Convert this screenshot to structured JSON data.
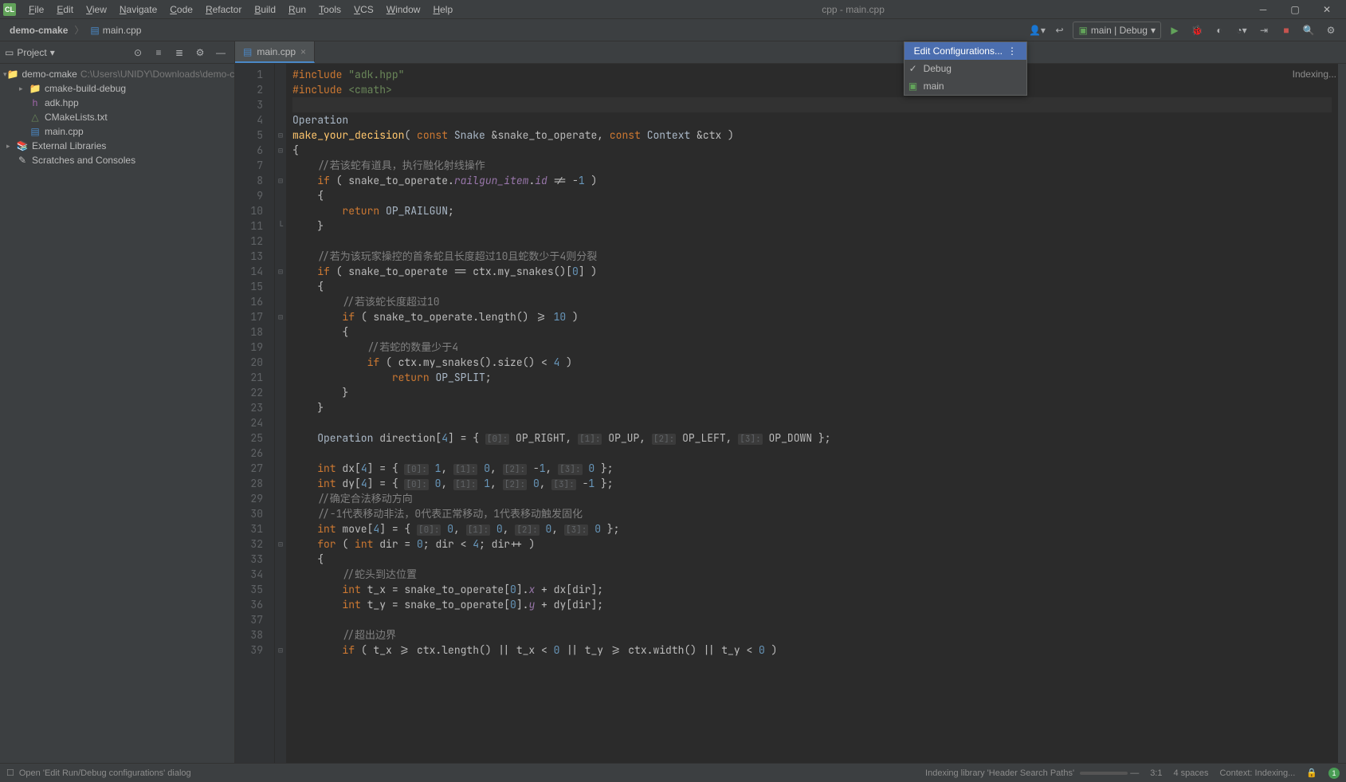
{
  "window_title": "cpp - main.cpp",
  "menu": [
    "File",
    "Edit",
    "View",
    "Navigate",
    "Code",
    "Refactor",
    "Build",
    "Run",
    "Tools",
    "VCS",
    "Window",
    "Help"
  ],
  "breadcrumb": {
    "project": "demo-cmake",
    "file_icon": "cpp",
    "file": "main.cpp"
  },
  "run_config_label": "main | Debug",
  "dropdown": {
    "edit": "Edit Configurations...",
    "items": [
      {
        "label": "Debug",
        "checked": true
      },
      {
        "label": "main",
        "checked": false,
        "icon": "app"
      }
    ]
  },
  "project_panel": {
    "title": "Project",
    "tree": [
      {
        "level": 0,
        "arrow": "▾",
        "icon": "folder",
        "label": "demo-cmake",
        "path": "C:\\Users\\UNIDY\\Downloads\\demo-cmake"
      },
      {
        "level": 1,
        "arrow": "▸",
        "icon": "folder",
        "label": "cmake-build-debug"
      },
      {
        "level": 1,
        "arrow": "",
        "icon": "hpp",
        "label": "adk.hpp"
      },
      {
        "level": 1,
        "arrow": "",
        "icon": "cmake",
        "label": "CMakeLists.txt"
      },
      {
        "level": 1,
        "arrow": "",
        "icon": "cpp",
        "label": "main.cpp"
      },
      {
        "level": 0,
        "arrow": "▸",
        "icon": "lib",
        "label": "External Libraries"
      },
      {
        "level": 0,
        "arrow": "",
        "icon": "scratch",
        "label": "Scratches and Consoles"
      }
    ]
  },
  "editor_tab": "main.cpp",
  "indexing_note": "Indexing...",
  "code_lines": [
    {
      "n": 1,
      "html": "<span class='kw'>#include</span> <span class='str'>\"adk.hpp\"</span>"
    },
    {
      "n": 2,
      "html": "<span class='kw'>#include</span> <span class='str'>&lt;cmath&gt;</span>"
    },
    {
      "n": 3,
      "html": ""
    },
    {
      "n": 4,
      "html": "<span class='type'>Operation</span>"
    },
    {
      "n": 5,
      "html": "<span class='fn'>make_your_decision</span>( <span class='kw'>const</span> <span class='type'>Snake</span> &amp;snake_to_operate, <span class='kw'>const</span> <span class='type'>Context</span> &amp;ctx )"
    },
    {
      "n": 6,
      "html": "{"
    },
    {
      "n": 7,
      "html": "    <span class='comment'>//若该蛇有道具，执行融化射线操作</span>"
    },
    {
      "n": 8,
      "html": "    <span class='kw'>if</span> ( snake_to_operate.<span class='purple'>railgun_item</span>.<span class='purple'>id</span> != -<span class='num'>1</span> )"
    },
    {
      "n": 9,
      "html": "    {"
    },
    {
      "n": 10,
      "html": "        <span class='kw'>return</span> <span class='ident'>OP_RAILGUN</span>;"
    },
    {
      "n": 11,
      "html": "    }"
    },
    {
      "n": 12,
      "html": ""
    },
    {
      "n": 13,
      "html": "    <span class='comment'>//若为该玩家操控的首条蛇且长度超过10且蛇数少于4则分裂</span>"
    },
    {
      "n": 14,
      "html": "    <span class='kw'>if</span> ( snake_to_operate == ctx.my_snakes()[<span class='num'>0</span>] )"
    },
    {
      "n": 15,
      "html": "    {"
    },
    {
      "n": 16,
      "html": "        <span class='comment'>//若该蛇长度超过10</span>"
    },
    {
      "n": 17,
      "html": "        <span class='kw'>if</span> ( snake_to_operate.length() &gt;= <span class='num'>10</span> )"
    },
    {
      "n": 18,
      "html": "        {"
    },
    {
      "n": 19,
      "html": "            <span class='comment'>//若蛇的数量少于4</span>"
    },
    {
      "n": 20,
      "html": "            <span class='kw'>if</span> ( ctx.my_snakes().size() &lt; <span class='num'>4</span> )"
    },
    {
      "n": 21,
      "html": "                <span class='kw'>return</span> <span class='ident'>OP_SPLIT</span>;"
    },
    {
      "n": 22,
      "html": "        }"
    },
    {
      "n": 23,
      "html": "    }"
    },
    {
      "n": 24,
      "html": ""
    },
    {
      "n": 25,
      "html": "    <span class='type'>Operation</span> direction[<span class='num'>4</span>] = { <span class='hint'>[0]:</span> OP_RIGHT, <span class='hint'>[1]:</span> OP_UP, <span class='hint'>[2]:</span> OP_LEFT, <span class='hint'>[3]:</span> OP_DOWN };"
    },
    {
      "n": 26,
      "html": ""
    },
    {
      "n": 27,
      "html": "    <span class='kw'>int</span> dx[<span class='num'>4</span>] = { <span class='hint'>[0]:</span> <span class='num'>1</span>, <span class='hint'>[1]:</span> <span class='num'>0</span>, <span class='hint'>[2]:</span> -<span class='num'>1</span>, <span class='hint'>[3]:</span> <span class='num'>0</span> };"
    },
    {
      "n": 28,
      "html": "    <span class='kw'>int</span> dy[<span class='num'>4</span>] = { <span class='hint'>[0]:</span> <span class='num'>0</span>, <span class='hint'>[1]:</span> <span class='num'>1</span>, <span class='hint'>[2]:</span> <span class='num'>0</span>, <span class='hint'>[3]:</span> -<span class='num'>1</span> };"
    },
    {
      "n": 29,
      "html": "    <span class='comment'>//确定合法移动方向</span>"
    },
    {
      "n": 30,
      "html": "    <span class='comment'>//-1代表移动非法，0代表正常移动，1代表移动触发固化</span>"
    },
    {
      "n": 31,
      "html": "    <span class='kw'>int</span> move[<span class='num'>4</span>] = { <span class='hint'>[0]:</span> <span class='num'>0</span>, <span class='hint'>[1]:</span> <span class='num'>0</span>, <span class='hint'>[2]:</span> <span class='num'>0</span>, <span class='hint'>[3]:</span> <span class='num'>0</span> };"
    },
    {
      "n": 32,
      "html": "    <span class='kw'>for</span> ( <span class='kw'>int</span> dir = <span class='num'>0</span>; dir &lt; <span class='num'>4</span>; dir++ )"
    },
    {
      "n": 33,
      "html": "    {"
    },
    {
      "n": 34,
      "html": "        <span class='comment'>//蛇头到达位置</span>"
    },
    {
      "n": 35,
      "html": "        <span class='kw'>int</span> t_x = snake_to_operate[<span class='num'>0</span>].<span class='purple'>x</span> + dx[dir];"
    },
    {
      "n": 36,
      "html": "        <span class='kw'>int</span> t_y = snake_to_operate[<span class='num'>0</span>].<span class='purple'>y</span> + dy[dir];"
    },
    {
      "n": 37,
      "html": ""
    },
    {
      "n": 38,
      "html": "        <span class='comment'>//超出边界</span>"
    },
    {
      "n": 39,
      "html": "        <span class='kw'>if</span> ( t_x &gt;= ctx.length() || t_x &lt; <span class='num'>0</span> || t_y &gt;= ctx.width() || t_y &lt; <span class='num'>0</span> )"
    }
  ],
  "fold_markers": {
    "5": "⊟",
    "6": "⊟",
    "8": "⊟",
    "11": "└",
    "14": "⊟",
    "17": "⊟",
    "32": "⊟",
    "39": "⊟"
  },
  "statusbar": {
    "left_icon": "☐",
    "left_text": "Open 'Edit Run/Debug configurations' dialog",
    "indexing": "Indexing library 'Header Search Paths'",
    "cursor": "3:1",
    "spaces": "4 spaces",
    "context": "Context: Indexing...",
    "warning_count": "1"
  }
}
